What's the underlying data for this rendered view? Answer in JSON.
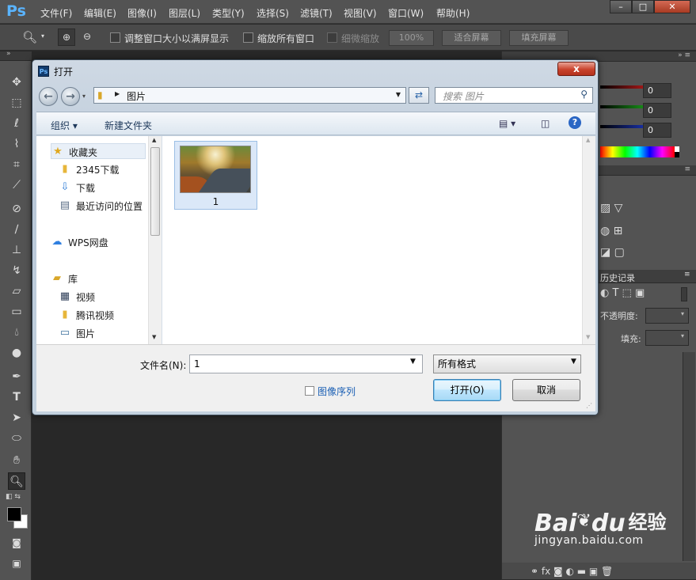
{
  "app": {
    "logo": "Ps",
    "menu": [
      "文件(F)",
      "编辑(E)",
      "图像(I)",
      "图层(L)",
      "类型(Y)",
      "选择(S)",
      "滤镜(T)",
      "视图(V)",
      "窗口(W)",
      "帮助(H)"
    ],
    "window_controls": {
      "minimize": "–",
      "maximize": "□",
      "close": "✕"
    }
  },
  "options_bar": {
    "zoom_in_icon": "zoom-in-icon",
    "zoom_out_icon": "zoom-out-icon",
    "resize_windows_label": "调整窗口大小以满屏显示",
    "zoom_all_label": "缩放所有窗口",
    "scrubby_label": "细微缩放",
    "zoom_value": "100%",
    "fit_screen_label": "适合屏幕",
    "fill_screen_label": "填充屏幕"
  },
  "right_panel": {
    "color_values": [
      "0",
      "0",
      "0"
    ],
    "slider_colors": [
      "#e02020",
      "#20c020",
      "#2040e0"
    ],
    "history_tab": "历史记录",
    "opacity_label": "不透明度:",
    "fill_label": "填充:"
  },
  "dialog": {
    "title": "打开",
    "close_label": "x",
    "address_path": "图片",
    "search_placeholder": "搜索 图片",
    "organize_label": "组织 ▾",
    "new_folder_label": "新建文件夹",
    "nav": {
      "favorites": "收藏夹",
      "favorites_items": [
        "2345下载",
        "下载",
        "最近访问的位置"
      ],
      "wps": "WPS网盘",
      "library": "库",
      "library_items": [
        "视频",
        "腾讯视频",
        "图片"
      ]
    },
    "file": {
      "name": "1"
    },
    "filename_label": "文件名(N):",
    "filename_value": "1",
    "filetype_value": "所有格式",
    "image_sequence_label": "图像序列",
    "open_button": "打开(O)",
    "cancel_button": "取消"
  },
  "watermark": {
    "brand": "Bai",
    "brand2": "du",
    "cn": "经验",
    "url": "jingyan.baidu.com"
  }
}
